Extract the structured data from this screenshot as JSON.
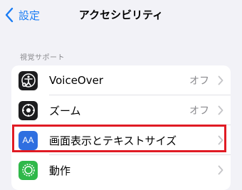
{
  "nav": {
    "back_label": "設定",
    "title": "アクセシビリティ"
  },
  "section": {
    "header": "視覚サポート",
    "items": [
      {
        "label": "VoiceOver",
        "value": "オフ",
        "icon": "voiceover-icon",
        "color": "#1c1c1e"
      },
      {
        "label": "ズーム",
        "value": "オフ",
        "icon": "zoom-icon",
        "color": "#1c1c1e"
      },
      {
        "label": "画面表示とテキストサイズ",
        "value": "",
        "icon": "text-size-icon",
        "color": "#2f6fe0"
      },
      {
        "label": "動作",
        "value": "",
        "icon": "motion-icon",
        "color": "#30b84a"
      }
    ]
  },
  "colors": {
    "accent": "#1a7cf4",
    "highlight": "#e01b24",
    "background": "#f2f2f7"
  },
  "icon_text": {
    "text_size": "AA"
  }
}
